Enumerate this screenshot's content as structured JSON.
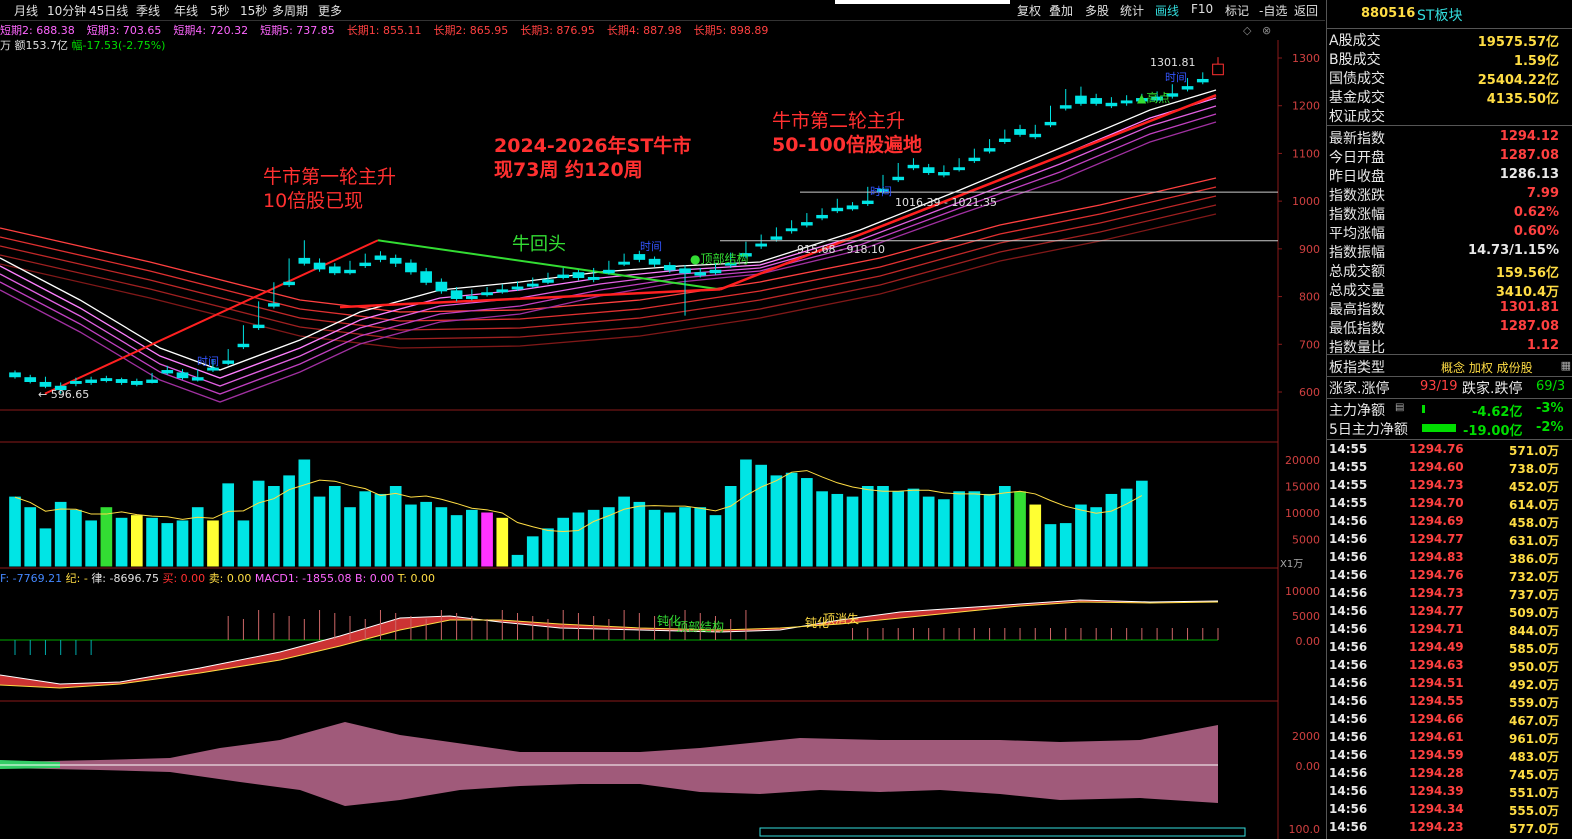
{
  "toolbar": {
    "left_items": [
      "月线",
      "10分钟",
      "45日线",
      "季线",
      "年线",
      "5秒",
      "15秒",
      "多周期",
      "更多"
    ],
    "right_items": [
      "复权",
      "叠加",
      "多股",
      "统计",
      "画线",
      "F10",
      "标记",
      "-自选",
      "返回"
    ],
    "active_right": "画线"
  },
  "ma_legend": [
    {
      "label": "短期2: 688.38",
      "color": "#ff66ff"
    },
    {
      "label": "短期3: 703.65",
      "color": "#ff66ff"
    },
    {
      "label": "短期4: 720.32",
      "color": "#ff66ff"
    },
    {
      "label": "短期5: 737.85",
      "color": "#ff66ff"
    },
    {
      "label": "长期1: 855.11",
      "color": "#ff4040"
    },
    {
      "label": "长期2: 865.95",
      "color": "#ff4040"
    },
    {
      "label": "长期3: 876.95",
      "color": "#ff4040"
    },
    {
      "label": "长期4: 887.98",
      "color": "#ff4040"
    },
    {
      "label": "长期5: 898.89",
      "color": "#ff4040"
    }
  ],
  "info_line": {
    "amount": "万 额153.7亿",
    "change": "幅-17.53(-2.75%)"
  },
  "annotations": {
    "stage1_title": "牛市第一轮主升",
    "stage1_sub": "10倍股已现",
    "bull_title": "2024-2026年ST牛市",
    "bull_sub": "现73周  约120周",
    "stage2_title": "牛市第二轮主升",
    "stage2_sub": "50-100倍股遍地",
    "pullback": "牛回头",
    "top_struct": "●顶部结构",
    "high_label": "▲高点",
    "range1": "1016.39 - 1021.35",
    "range2": "915.68 - 918.10",
    "low_value": "← 596.65",
    "high_value": "1301.81",
    "time_tag": "时间"
  },
  "macd_legend": {
    "dif": "F: -7769.21",
    "ji": "纪: -",
    "lv": "律: -8696.75",
    "buy": "买: 0.00",
    "sell": "卖: 0.00",
    "macd1": "MACD1: -1855.08",
    "b": "B: 0.00",
    "t": "T: 0.00"
  },
  "macd_labels": {
    "dun1": "钝化",
    "top1": "顶部结构",
    "dun2": "钝化",
    "top2": "顶消失"
  },
  "vol_unit": "X1万",
  "axis": {
    "price_ticks": [
      "1300",
      "1200",
      "1100",
      "1000",
      "900",
      "800",
      "700",
      "600"
    ],
    "vol_ticks": [
      "20000",
      "15000",
      "10000",
      "5000"
    ],
    "macd_ticks": [
      "10000",
      "5000",
      "0.00"
    ],
    "osc_ticks": [
      "2000",
      "0.00"
    ],
    "bottom_tick": "100.0"
  },
  "sidebar": {
    "code": "880516",
    "name": "ST板块",
    "trade_rows": [
      {
        "label": "A股成交",
        "value": "19575.57亿",
        "color": "#ffdd44"
      },
      {
        "label": "B股成交",
        "value": "1.59亿",
        "color": "#ffdd44"
      },
      {
        "label": "国债成交",
        "value": "25404.22亿",
        "color": "#ffdd44"
      },
      {
        "label": "基金成交",
        "value": "4135.50亿",
        "color": "#ffdd44"
      },
      {
        "label": "权证成交",
        "value": "",
        "color": "#ffdd44"
      }
    ],
    "index_rows": [
      {
        "label": "最新指数",
        "value": "1294.12",
        "color": "#ff4040"
      },
      {
        "label": "今日开盘",
        "value": "1287.08",
        "color": "#ff4040"
      },
      {
        "label": "昨日收盘",
        "value": "1286.13",
        "color": "#e8e8e8"
      },
      {
        "label": "指数涨跌",
        "value": "7.99",
        "color": "#ff4040"
      },
      {
        "label": "指数涨幅",
        "value": "0.62%",
        "color": "#ff4040"
      },
      {
        "label": "平均涨幅",
        "value": "0.60%",
        "color": "#ff4040"
      },
      {
        "label": "指数振幅",
        "value": "14.73/1.15%",
        "color": "#e8e8e8"
      },
      {
        "label": "总成交额",
        "value": "159.56亿",
        "color": "#ffdd44"
      },
      {
        "label": "总成交量",
        "value": "3410.4万",
        "color": "#ffdd44"
      },
      {
        "label": "最高指数",
        "value": "1301.81",
        "color": "#ff4040"
      },
      {
        "label": "最低指数",
        "value": "1287.08",
        "color": "#ff4040"
      },
      {
        "label": "指数量比",
        "value": "1.12",
        "color": "#ff4040"
      }
    ],
    "board_type_label": "板指类型",
    "board_type_value": "概念 加权 成份股",
    "updown_label": "涨家.涨停",
    "updown_value": "93/19",
    "downup_label": "跌家.跌停",
    "downup_value": "69/3",
    "main_net_label": "主力净额",
    "main_net_value": "-4.62亿",
    "main_net_pct": "-3%",
    "main5_label": "5日主力净额",
    "main5_value": "-19.00亿",
    "main5_pct": "-2%",
    "ticks": [
      {
        "t": "14:55",
        "p": "1294.76",
        "v": "571.0万"
      },
      {
        "t": "14:55",
        "p": "1294.60",
        "v": "738.0万"
      },
      {
        "t": "14:55",
        "p": "1294.73",
        "v": "452.0万"
      },
      {
        "t": "14:55",
        "p": "1294.70",
        "v": "614.0万"
      },
      {
        "t": "14:56",
        "p": "1294.69",
        "v": "458.0万"
      },
      {
        "t": "14:56",
        "p": "1294.77",
        "v": "631.0万"
      },
      {
        "t": "14:56",
        "p": "1294.83",
        "v": "386.0万"
      },
      {
        "t": "14:56",
        "p": "1294.76",
        "v": "732.0万"
      },
      {
        "t": "14:56",
        "p": "1294.73",
        "v": "737.0万"
      },
      {
        "t": "14:56",
        "p": "1294.77",
        "v": "509.0万"
      },
      {
        "t": "14:56",
        "p": "1294.71",
        "v": "844.0万"
      },
      {
        "t": "14:56",
        "p": "1294.49",
        "v": "585.0万"
      },
      {
        "t": "14:56",
        "p": "1294.63",
        "v": "950.0万"
      },
      {
        "t": "14:56",
        "p": "1294.51",
        "v": "492.0万"
      },
      {
        "t": "14:56",
        "p": "1294.55",
        "v": "559.0万"
      },
      {
        "t": "14:56",
        "p": "1294.66",
        "v": "467.0万"
      },
      {
        "t": "14:56",
        "p": "1294.61",
        "v": "961.0万"
      },
      {
        "t": "14:56",
        "p": "1294.59",
        "v": "483.0万"
      },
      {
        "t": "14:56",
        "p": "1294.28",
        "v": "745.0万"
      },
      {
        "t": "14:56",
        "p": "1294.39",
        "v": "551.0万"
      },
      {
        "t": "14:56",
        "p": "1294.34",
        "v": "555.0万"
      },
      {
        "t": "14:56",
        "p": "1294.23",
        "v": "577.0万"
      }
    ]
  },
  "chart_data": {
    "type": "candlestick",
    "ylim": [
      560,
      1340
    ],
    "ylabel": "",
    "candles": [
      [
        640,
        645,
        632,
        628
      ],
      [
        630,
        636,
        622,
        618
      ],
      [
        620,
        632,
        612,
        608
      ],
      [
        612,
        620,
        605,
        596.65
      ],
      [
        622,
        630,
        618,
        612
      ],
      [
        625,
        632,
        620,
        615
      ],
      [
        628,
        634,
        624,
        620
      ],
      [
        626,
        630,
        620,
        615
      ],
      [
        622,
        628,
        616,
        612
      ],
      [
        625,
        640,
        620,
        618
      ],
      [
        645,
        655,
        640,
        636
      ],
      [
        640,
        648,
        630,
        626
      ],
      [
        630,
        648,
        625,
        622
      ],
      [
        650,
        668,
        646,
        642
      ],
      [
        665,
        690,
        660,
        656
      ],
      [
        700,
        740,
        695,
        690
      ],
      [
        740,
        790,
        735,
        730
      ],
      [
        785,
        830,
        780,
        775
      ],
      [
        830,
        880,
        825,
        820
      ],
      [
        880,
        918,
        870,
        865
      ],
      [
        870,
        880,
        858,
        852
      ],
      [
        862,
        870,
        850,
        845
      ],
      [
        855,
        875,
        850,
        846
      ],
      [
        870,
        890,
        865,
        860
      ],
      [
        885,
        895,
        878,
        872
      ],
      [
        880,
        888,
        870,
        862
      ],
      [
        870,
        878,
        852,
        846
      ],
      [
        852,
        860,
        830,
        824
      ],
      [
        830,
        838,
        812,
        806
      ],
      [
        812,
        820,
        796,
        790
      ],
      [
        800,
        815,
        796,
        792
      ],
      [
        808,
        820,
        804,
        800
      ],
      [
        814,
        826,
        810,
        806
      ],
      [
        820,
        832,
        816,
        812
      ],
      [
        826,
        840,
        822,
        818
      ],
      [
        835,
        850,
        830,
        826
      ],
      [
        845,
        860,
        840,
        836
      ],
      [
        850,
        856,
        840,
        834
      ],
      [
        840,
        860,
        836,
        830
      ],
      [
        855,
        875,
        850,
        846
      ],
      [
        872,
        890,
        868,
        864
      ],
      [
        888,
        896,
        878,
        872
      ],
      [
        878,
        884,
        868,
        862
      ],
      [
        865,
        872,
        856,
        850
      ],
      [
        858,
        866,
        850,
        760
      ],
      [
        850,
        860,
        845,
        840
      ],
      [
        855,
        870,
        850,
        846
      ],
      [
        870,
        892,
        866,
        860
      ],
      [
        890,
        915,
        885,
        880
      ],
      [
        910,
        930,
        906,
        900
      ],
      [
        925,
        945,
        920,
        915
      ],
      [
        942,
        960,
        938,
        932
      ],
      [
        955,
        975,
        950,
        945
      ],
      [
        970,
        985,
        965,
        960
      ],
      [
        985,
        1005,
        980,
        975
      ],
      [
        990,
        998,
        984,
        980
      ],
      [
        1000,
        1030,
        995,
        990
      ],
      [
        1025,
        1055,
        1020,
        1015
      ],
      [
        1050,
        1080,
        1045,
        1040
      ],
      [
        1075,
        1090,
        1070,
        1065
      ],
      [
        1070,
        1078,
        1060,
        1055
      ],
      [
        1060,
        1075,
        1055,
        1050
      ],
      [
        1070,
        1090,
        1066,
        1062
      ],
      [
        1090,
        1110,
        1085,
        1080
      ],
      [
        1110,
        1130,
        1105,
        1100
      ],
      [
        1130,
        1150,
        1125,
        1120
      ],
      [
        1150,
        1160,
        1140,
        1135
      ],
      [
        1140,
        1160,
        1135,
        1130
      ],
      [
        1165,
        1200,
        1160,
        1155
      ],
      [
        1200,
        1235,
        1195,
        1190
      ],
      [
        1220,
        1240,
        1205,
        1200
      ],
      [
        1215,
        1225,
        1205,
        1200
      ],
      [
        1205,
        1218,
        1200,
        1195
      ],
      [
        1210,
        1222,
        1206,
        1200
      ],
      [
        1215,
        1225,
        1210,
        1205
      ],
      [
        1218,
        1230,
        1212,
        1208
      ],
      [
        1225,
        1245,
        1220,
        1215
      ],
      [
        1240,
        1258,
        1235,
        1230
      ],
      [
        1255,
        1270,
        1250,
        1245
      ],
      [
        1265,
        1301.81,
        1287.08,
        1287.08
      ]
    ],
    "volumes": [
      13000,
      11000,
      7000,
      12000,
      10500,
      8500,
      11000,
      9000,
      9500,
      9000,
      8000,
      8500,
      11000,
      8500,
      15500,
      8500,
      16000,
      15000,
      17000,
      20000,
      13000,
      15000,
      11000,
      14000,
      13500,
      15000,
      11500,
      12000,
      11000,
      9500,
      10500,
      10000,
      9000,
      2000,
      5500,
      7000,
      9000,
      10000,
      10500,
      11000,
      13000,
      12000,
      10500,
      10000,
      11000,
      11000,
      9500,
      15000,
      20000,
      19000,
      17000,
      17500,
      16500,
      14000,
      13500,
      13000,
      15000,
      15000,
      14000,
      14500,
      13000,
      12500,
      14000,
      14000,
      13500,
      15000,
      14000,
      11500,
      7800,
      8000,
      11500,
      11000,
      13500,
      14500,
      16000
    ]
  }
}
